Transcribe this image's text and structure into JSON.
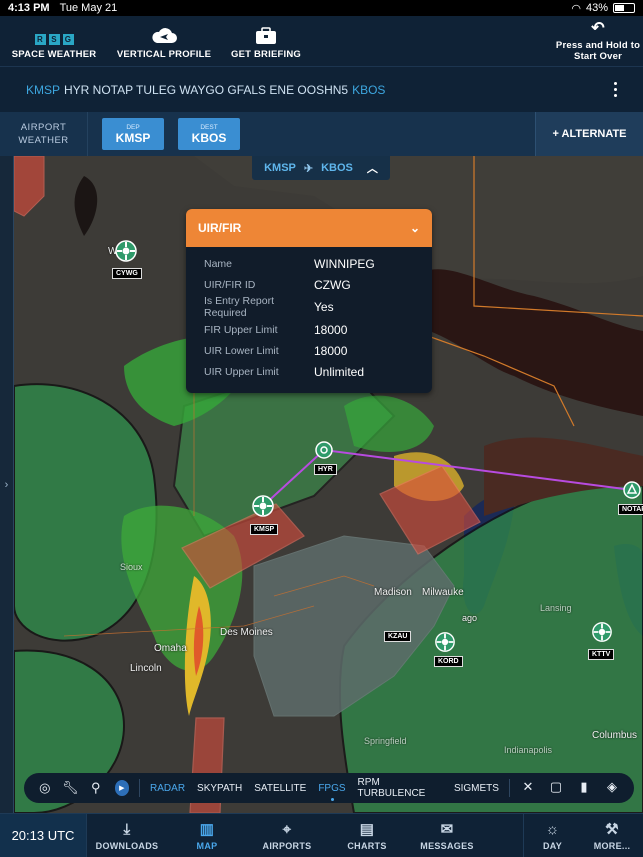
{
  "status": {
    "time": "4:13 PM",
    "date": "Tue May 21",
    "battery": "43%"
  },
  "toolbar": {
    "rsg": [
      "R",
      "S",
      "G"
    ],
    "space_weather": "SPACE WEATHER",
    "vertical_profile": "VERTICAL PROFILE",
    "get_briefing": "GET BRIEFING",
    "reset": "Press and Hold to Start Over"
  },
  "route": {
    "departure": "KMSP",
    "waypoints": "HYR NOTAP TULEG WAYGO GFALS ENE OOSHN5",
    "destination": "KBOS"
  },
  "airport_weather": {
    "label": "AIRPORT WEATHER",
    "dep_label": "DEP",
    "dep": "KMSP",
    "dest_label": "DEST",
    "dest": "KBOS",
    "alternate": "+ ALTERNATE"
  },
  "route_chip": {
    "from": "KMSP",
    "plane": "✈",
    "to": "KBOS"
  },
  "popup": {
    "title": "UIR/FIR",
    "rows": [
      {
        "key": "Name",
        "value": "WINNIPEG"
      },
      {
        "key": "UIR/FIR ID",
        "value": "CZWG"
      },
      {
        "key": "Is Entry Report Required",
        "value": "Yes"
      },
      {
        "key": "FIR Upper Limit",
        "value": "18000"
      },
      {
        "key": "UIR Lower Limit",
        "value": "18000"
      },
      {
        "key": "UIR Upper Limit",
        "value": "Unlimited"
      }
    ]
  },
  "map": {
    "labels": {
      "winnipeg": "W   eg",
      "madison": "Madison",
      "milwaukee": "Milwauke",
      "des_moines": "Des Moines",
      "omaha": "Omaha",
      "lincoln": "Lincoln",
      "columbus": "Columbus",
      "indianapolis": "Indianapolis",
      "springfield": "Springfield",
      "lansing": "Lansing",
      "chicago": "ago",
      "sioux": "Sioux"
    },
    "airports": [
      "CYWG",
      "HYR",
      "KMSP",
      "NOTAP",
      "KZAU",
      "KORD",
      "KTTV"
    ]
  },
  "layers": {
    "items": [
      "RADAR",
      "SKYPATH",
      "SATELLITE",
      "FPGS",
      "RPM TURBULENCE",
      "SIGMETS"
    ],
    "active": "FPGS"
  },
  "tabs": {
    "clock": "20:13 UTC",
    "downloads": "DOWNLOADS",
    "map": "MAP",
    "airports": "AIRPORTS",
    "charts": "CHARTS",
    "messages": "MESSAGES",
    "day": "DAY",
    "more": "MORE..."
  },
  "colors": {
    "accent": "#3da7e0",
    "popup_header": "#ee8636",
    "route_line": "#b84be0"
  }
}
